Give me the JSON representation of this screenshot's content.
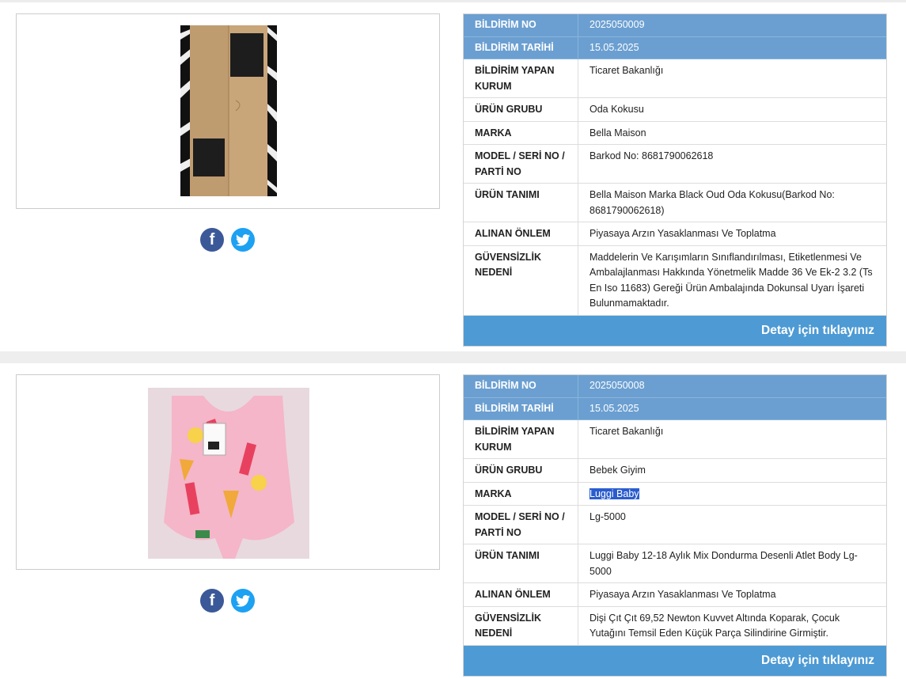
{
  "social": {
    "facebook_icon": "facebook-icon",
    "twitter_icon": "twitter-icon"
  },
  "records": [
    {
      "image_desc": "cardboard box",
      "rows": [
        {
          "label": "BİLDİRİM NO",
          "value": "2025050009"
        },
        {
          "label": "BİLDİRİM TARİHİ",
          "value": "15.05.2025"
        },
        {
          "label": "BİLDİRİM YAPAN KURUM",
          "value": "Ticaret Bakanlığı"
        },
        {
          "label": "ÜRÜN GRUBU",
          "value": "Oda Kokusu"
        },
        {
          "label": "MARKA",
          "value": "Bella Maison"
        },
        {
          "label": "MODEL / SERİ NO / PARTİ NO",
          "value": "Barkod No: 8681790062618"
        },
        {
          "label": "ÜRÜN TANIMI",
          "value": "Bella Maison Marka Black Oud Oda Kokusu(Barkod No: 8681790062618)"
        },
        {
          "label": "ALINAN ÖNLEM",
          "value": "Piyasaya Arzın Yasaklanması Ve Toplatma"
        },
        {
          "label": "GÜVENSİZLİK NEDENİ",
          "value": "Maddelerin Ve Karışımların Sınıflandırılması, Etiketlenmesi Ve Ambalajlanması Hakkında Yönetmelik Madde 36 Ve Ek-2 3.2 (Ts En Iso 11683) Gereği Ürün Ambalajında Dokunsal Uyarı İşareti Bulunmamaktadır."
        }
      ],
      "detail_link": "Detay için tıklayınız"
    },
    {
      "image_desc": "pink baby bodysuit",
      "rows": [
        {
          "label": "BİLDİRİM NO",
          "value": "2025050008"
        },
        {
          "label": "BİLDİRİM TARİHİ",
          "value": "15.05.2025"
        },
        {
          "label": "BİLDİRİM YAPAN KURUM",
          "value": "Ticaret Bakanlığı"
        },
        {
          "label": "ÜRÜN GRUBU",
          "value": "Bebek Giyim"
        },
        {
          "label": "MARKA",
          "value": "Luggi Baby"
        },
        {
          "label": "MODEL / SERİ NO / PARTİ NO",
          "value": "Lg-5000"
        },
        {
          "label": "ÜRÜN TANIMI",
          "value": "Luggi Baby 12-18 Aylık Mix Dondurma Desenli Atlet Body Lg-5000"
        },
        {
          "label": "ALINAN ÖNLEM",
          "value": "Piyasaya Arzın Yasaklanması Ve Toplatma"
        },
        {
          "label": "GÜVENSİZLİK NEDENİ",
          "value": "Dişi Çıt Çıt 69,52 Newton Kuvvet Altında Koparak, Çocuk Yutağını Temsil Eden Küçük Parça Silindirine Girmiştir."
        }
      ],
      "detail_link": "Detay için tıklayınız"
    }
  ],
  "colors": {
    "header_row": "#6b9fd1",
    "detail_bar": "#4d9ad4",
    "facebook": "#3b5998",
    "twitter": "#1da1f2",
    "selection": "#2a5cce"
  }
}
